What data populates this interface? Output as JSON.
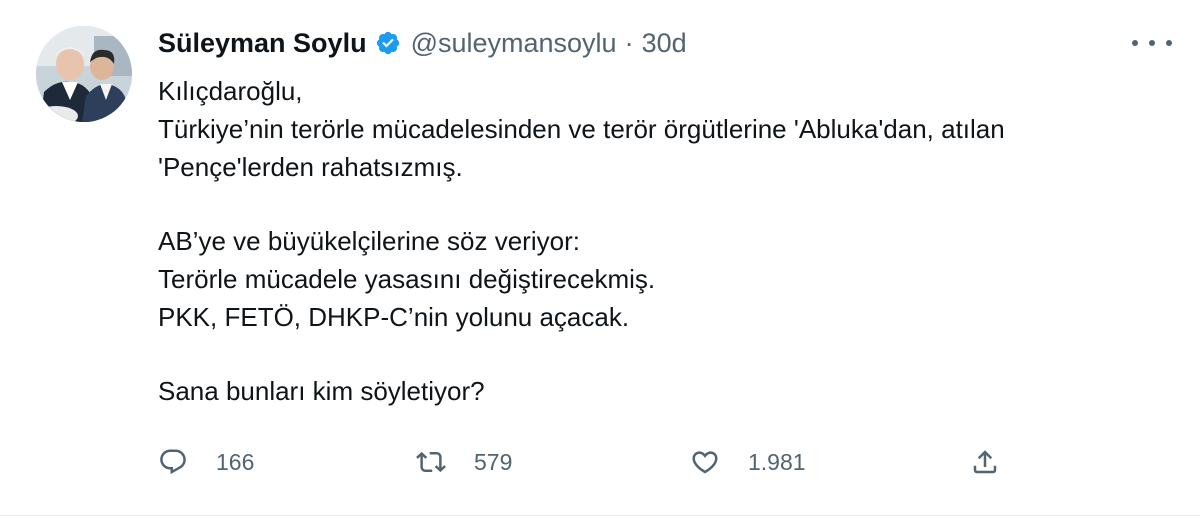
{
  "tweet": {
    "author_name": "Süleyman Soylu",
    "handle": "@suleymansoylu",
    "separator": "·",
    "time": "30d",
    "lines": [
      "Kılıçdaroğlu,",
      "Türkiye’nin terörle mücadelesinden ve terör örgütlerine 'Abluka'dan, atılan",
      "'Pençe'lerden rahatsızmış.",
      "",
      "AB’ye ve büyükelçilerine söz veriyor:",
      "Terörle mücadele yasasını değiştirecekmiş.",
      "PKK, FETÖ, DHKP-C’nin yolunu açacak.",
      "",
      "Sana bunları kim söyletiyor?"
    ],
    "stats": {
      "replies": "166",
      "retweets": "579",
      "likes": "1.981"
    }
  },
  "icons": {
    "verified": "verified-badge-icon",
    "more": "more-icon",
    "reply": "reply-icon",
    "retweet": "retweet-icon",
    "like": "like-icon",
    "share": "share-icon"
  },
  "colors": {
    "text": "#0f1419",
    "secondary": "#536471",
    "verified": "#1d9bf0",
    "border": "#e6ecf0"
  }
}
